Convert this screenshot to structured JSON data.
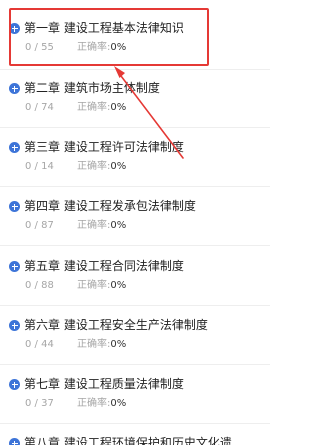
{
  "chapters": [
    {
      "title": "第一章 建设工程基本法律知识",
      "count": "0 / 55",
      "rate_label": "正确率:",
      "rate_value": "0%"
    },
    {
      "title": "第二章 建筑市场主体制度",
      "count": "0 / 74",
      "rate_label": "正确率:",
      "rate_value": "0%"
    },
    {
      "title": "第三章 建设工程许可法律制度",
      "count": "0 / 14",
      "rate_label": "正确率:",
      "rate_value": "0%"
    },
    {
      "title": "第四章 建设工程发承包法律制度",
      "count": "0 / 87",
      "rate_label": "正确率:",
      "rate_value": "0%"
    },
    {
      "title": "第五章 建设工程合同法律制度",
      "count": "0 / 88",
      "rate_label": "正确率:",
      "rate_value": "0%"
    },
    {
      "title": "第六章 建设工程安全生产法律制度",
      "count": "0 / 44",
      "rate_label": "正确率:",
      "rate_value": "0%"
    },
    {
      "title": "第七章 建设工程质量法律制度",
      "count": "0 / 37",
      "rate_label": "正确率:",
      "rate_value": "0%"
    },
    {
      "title": "第八章 建设工程环境保护和历史文化遗",
      "count": "",
      "rate_label": "",
      "rate_value": ""
    }
  ],
  "colors": {
    "expand_icon": "#3d74d8",
    "highlight": "#e53935",
    "title_text": "#222222",
    "meta_text": "#a6a6a6"
  },
  "icons": {
    "expand": "plus-circle-icon",
    "annotation": "arrow-icon"
  }
}
